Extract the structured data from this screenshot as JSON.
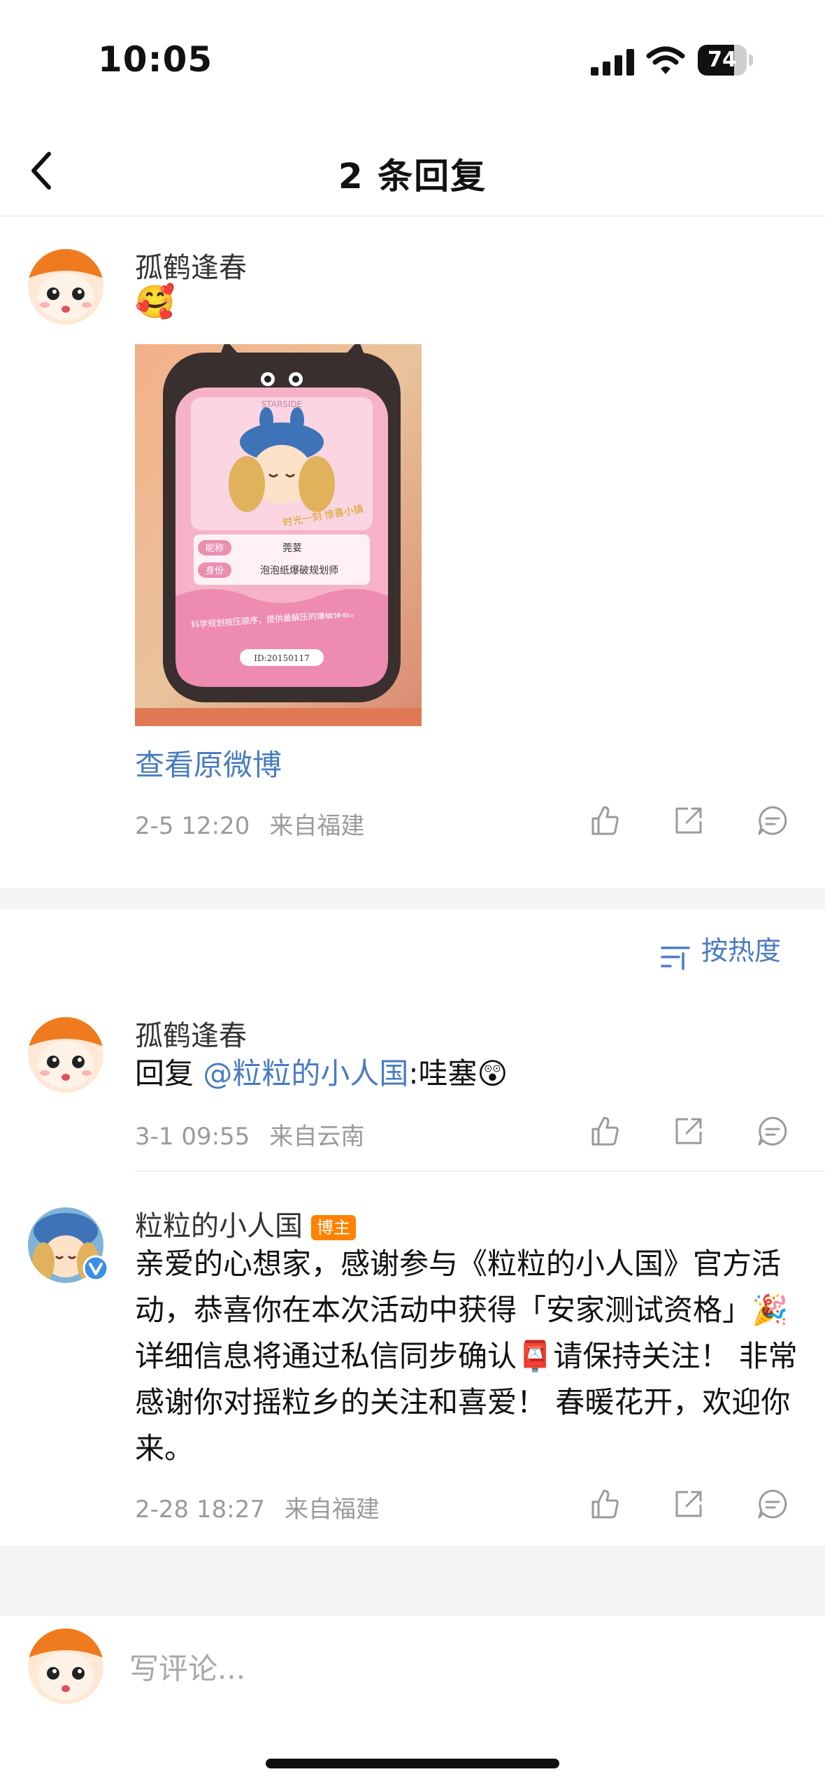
{
  "status_bar": {
    "time": "10:05",
    "battery": "74",
    "battery_level": 0.74
  },
  "header": {
    "title": "2 条回复"
  },
  "root_comment": {
    "username": "孤鹤逢春",
    "emoji": "🥰",
    "card": {
      "brand": "STARSIDE",
      "name_label": "昵称",
      "name_value": "莞荽",
      "identity_label": "身份",
      "identity_value": "泡泡纸爆破规划师",
      "description": "科学规划按压顺序，提供最解压的爆破体验。",
      "id_text": "ID:20150117",
      "stamp_text": "时光一刻 惊喜小镇"
    },
    "view_original": "查看原微博",
    "time": "2-5 12:20",
    "location": "来自福建"
  },
  "sort": {
    "label": "按热度"
  },
  "replies": [
    {
      "username": "孤鹤逢春",
      "prefix": "回复",
      "mention": "@粒粒的小人国",
      "suffix": ":哇塞",
      "emoji": "😲",
      "time": "3-1 09:55",
      "location": "来自云南"
    },
    {
      "username": "粒粒的小人国",
      "badge": "博主",
      "text_part1": "亲爱的心想家，感谢参与《粒粒的小人国》官方活动，恭喜你在本次活动中获得「安家测试资格」",
      "emoji1": "🎉",
      "text_part2": "详细信息将通过私信同步确认",
      "emoji2": "📮",
      "text_part3": "请保持关注！ 非常感谢你对摇粒乡的关注和喜爱！ 春暖花开，欢迎你来。",
      "time": "2-28 18:27",
      "location": "来自福建"
    }
  ],
  "bottom": {
    "input_placeholder": "写评论..."
  },
  "colors": {
    "link": "#4a7cc0",
    "meta": "#9b9b9b",
    "badge": "#ff8200",
    "gap": "#f4f4f4"
  },
  "icons": [
    "back-icon",
    "like-icon",
    "share-icon",
    "comment-icon",
    "sort-icon",
    "verified-icon"
  ]
}
